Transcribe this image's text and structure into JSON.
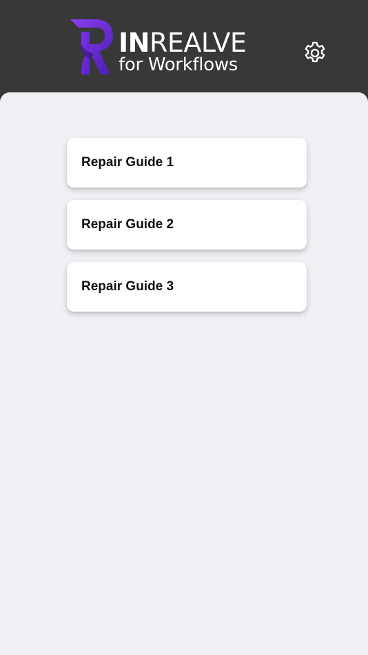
{
  "header": {
    "logo": {
      "wordmark_bold": "IN",
      "wordmark_light": "REALVE",
      "subtitle": "for Workflows"
    },
    "settings_icon": "gear-icon"
  },
  "guides": [
    {
      "label": "Repair Guide 1"
    },
    {
      "label": "Repair Guide 2"
    },
    {
      "label": "Repair Guide 3"
    }
  ],
  "colors": {
    "header_bg": "#383838",
    "content_bg": "#f1f0f5",
    "card_bg": "#ffffff",
    "brand_purple": "#6a2bd9"
  }
}
